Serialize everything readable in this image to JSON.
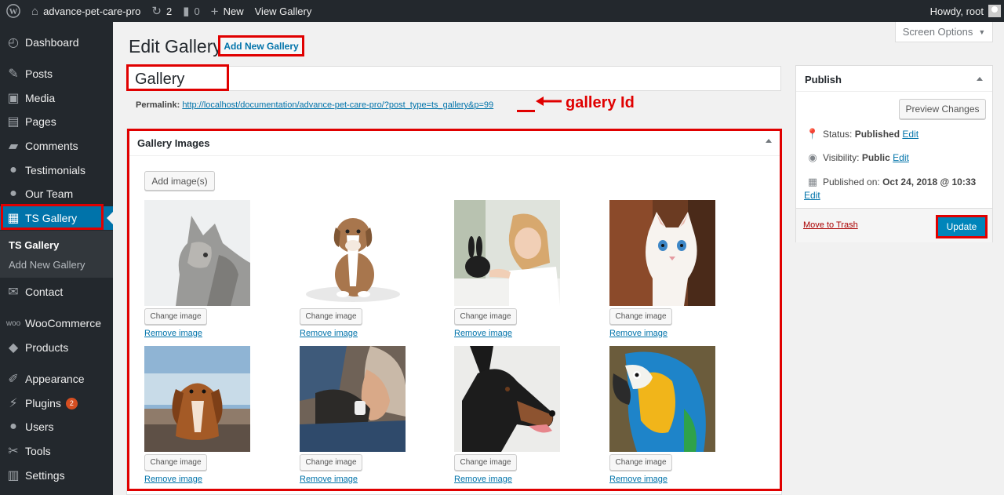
{
  "adminbar": {
    "site_name": "advance-pet-care-pro",
    "updates_count": "2",
    "comments_count": "0",
    "new_label": "New",
    "view_label": "View Gallery",
    "howdy": "Howdy, root"
  },
  "sidebar": {
    "items": [
      {
        "label": "Dashboard",
        "icon": "dashboard-icon"
      },
      {
        "label": "Posts",
        "icon": "pin-icon"
      },
      {
        "label": "Media",
        "icon": "media-icon"
      },
      {
        "label": "Pages",
        "icon": "pages-icon"
      },
      {
        "label": "Comments",
        "icon": "comment-icon"
      },
      {
        "label": "Testimonials",
        "icon": "person-icon"
      },
      {
        "label": "Our Team",
        "icon": "person-icon"
      },
      {
        "label": "TS Gallery",
        "icon": "gallery-icon"
      },
      {
        "label": "Contact",
        "icon": "mail-icon"
      },
      {
        "label": "WooCommerce",
        "icon": "woo-icon"
      },
      {
        "label": "Products",
        "icon": "box-icon"
      },
      {
        "label": "Appearance",
        "icon": "brush-icon"
      },
      {
        "label": "Plugins",
        "icon": "plug-icon",
        "badge": "2"
      },
      {
        "label": "Users",
        "icon": "users-icon"
      },
      {
        "label": "Tools",
        "icon": "wrench-icon"
      },
      {
        "label": "Settings",
        "icon": "settings-icon"
      }
    ],
    "submenu": [
      "TS Gallery",
      "Add New Gallery"
    ]
  },
  "screen_options": "Screen Options",
  "page": {
    "title": "Edit Gallery",
    "add_new": "Add New Gallery",
    "post_title": "Gallery",
    "permalink_label": "Permalink:",
    "permalink_url": "http://localhost/documentation/advance-pet-care-pro/?post_type=ts_gallery&p=99",
    "annotation": "gallery Id"
  },
  "gallery_box": {
    "title": "Gallery Images",
    "add_images": "Add image(s)",
    "change_label": "Change image",
    "remove_label": "Remove image",
    "images": [
      "cat",
      "puppy",
      "girl-with-rabbit",
      "white-kitten",
      "spaniel",
      "man-with-cat",
      "doberman",
      "parrot"
    ]
  },
  "publish": {
    "title": "Publish",
    "preview": "Preview Changes",
    "status_label": "Status:",
    "status_value": "Published",
    "visibility_label": "Visibility:",
    "visibility_value": "Public",
    "published_label": "Published on:",
    "published_value": "Oct 24, 2018 @ 10:33",
    "edit": "Edit",
    "trash": "Move to Trash",
    "update": "Update"
  },
  "colors": {
    "accent": "#0073aa",
    "highlight": "#e00000",
    "sidebar": "#23282d"
  }
}
